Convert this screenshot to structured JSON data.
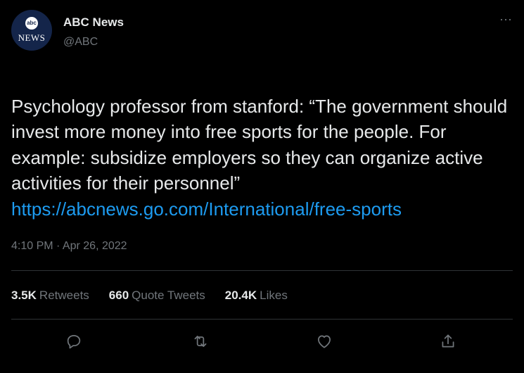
{
  "author": {
    "name": "ABC News",
    "handle": "@ABC",
    "avatar_logo": "abc",
    "avatar_text": "NEWS"
  },
  "menu": {
    "more_icon": "more-horizontal-icon",
    "more_label": "···"
  },
  "tweet": {
    "text": "Psychology professor from stanford: “The government should invest more money into free sports for the people. For example: subsidize employers so they can organize active activities for their personnel”",
    "link": "https://abcnews.go.com/International/free-sports",
    "timestamp": "4:10 PM · Apr 26, 2022"
  },
  "stats": {
    "retweets_count": "3.5K",
    "retweets_label": "Retweets",
    "quotes_count": "660",
    "quotes_label": "Quote Tweets",
    "likes_count": "20.4K",
    "likes_label": "Likes"
  },
  "actions": {
    "reply_icon": "reply-icon",
    "retweet_icon": "retweet-icon",
    "like_icon": "like-icon",
    "share_icon": "share-icon"
  },
  "colors": {
    "background": "#000000",
    "text": "#e7e9ea",
    "secondary": "#71767b",
    "link": "#1d9bf0",
    "divider": "#2f3336"
  }
}
